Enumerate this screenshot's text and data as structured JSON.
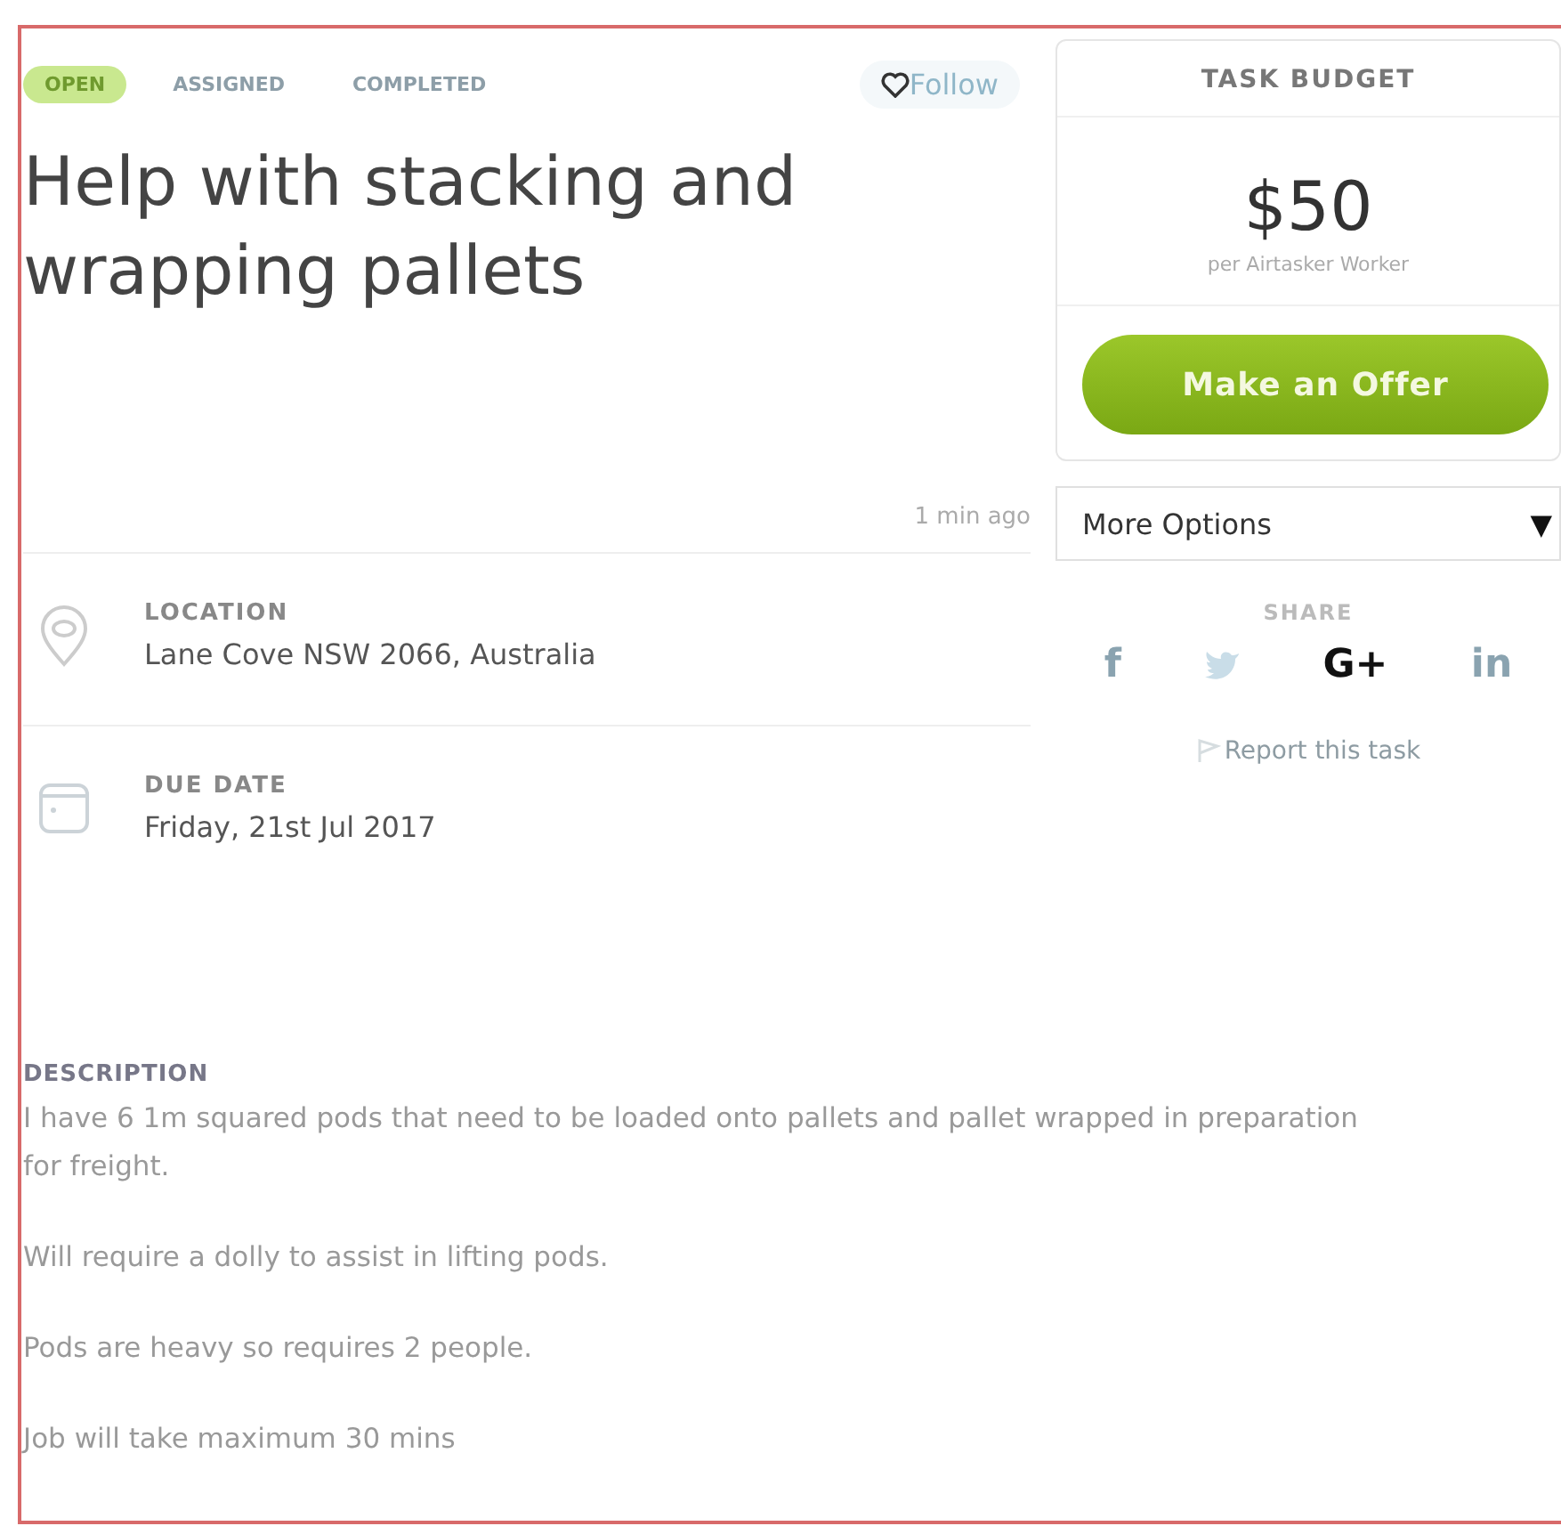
{
  "statuses": [
    {
      "label": "OPEN",
      "selected": true
    },
    {
      "label": "ASSIGNED",
      "selected": false
    },
    {
      "label": "COMPLETED",
      "selected": false
    }
  ],
  "follow": {
    "label": "Follow"
  },
  "title": "Help with stacking and wrapping pallets",
  "posted": "1 min ago",
  "details": [
    {
      "kind": "location",
      "label": "LOCATION",
      "value": "Lane Cove NSW 2066, Australia"
    },
    {
      "kind": "date",
      "label": "DUE DATE",
      "value": "Friday, 21st Jul 2017"
    }
  ],
  "description": {
    "label": "DESCRIPTION",
    "paragraphs": [
      "I have 6 1m squared pods that need to be loaded onto pallets and pallet wrapped in preparation for freight.",
      "Will require a dolly to assist in lifting pods.",
      "Pods are heavy so requires 2 people.",
      "Job will take maximum 30 mins"
    ]
  },
  "budget": {
    "label": "TASK BUDGET",
    "amount": "$50",
    "note": "per Airtasker Worker",
    "button": "Make an Offer"
  },
  "more_options": {
    "label": "More Options",
    "caret": "▼"
  },
  "share": {
    "label": "SHARE",
    "items": [
      {
        "kind": "text",
        "label": "f",
        "active": false
      },
      {
        "kind": "bird",
        "active": false
      },
      {
        "kind": "text",
        "label": "G+",
        "active": true
      },
      {
        "kind": "text",
        "label": "in",
        "active": false
      }
    ]
  },
  "report": {
    "label": "Report this task"
  }
}
